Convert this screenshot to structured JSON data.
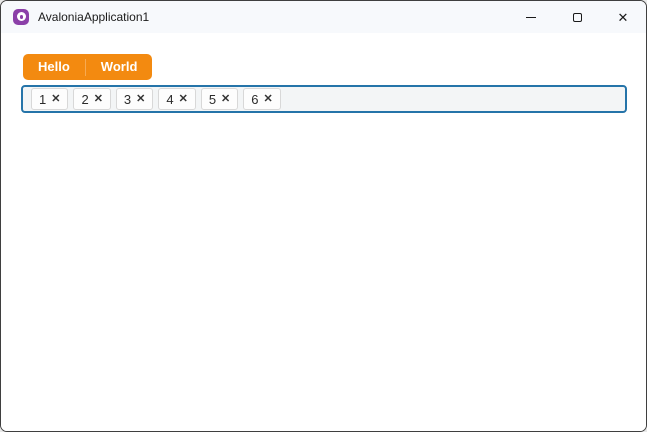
{
  "window": {
    "title": "AvaloniaApplication1",
    "controls": {
      "minimize_icon": "minimize-line",
      "maximize_icon": "maximize-square",
      "close_glyph": "✕"
    }
  },
  "colors": {
    "accent_orange": "#F38A10",
    "tab_divider_orange": "#F7AA52",
    "focus_border_blue": "#2574A9",
    "logo_purple": "#8B3FA8",
    "titlebar_bg": "#F7F9FC",
    "chips_box_bg": "#F3F5F6"
  },
  "tabs": {
    "items": [
      {
        "label": "Hello"
      },
      {
        "label": "World"
      }
    ]
  },
  "chips": {
    "remove_icon": "✕",
    "items": [
      {
        "label": "1"
      },
      {
        "label": "2"
      },
      {
        "label": "3"
      },
      {
        "label": "4"
      },
      {
        "label": "5"
      },
      {
        "label": "6"
      }
    ]
  }
}
